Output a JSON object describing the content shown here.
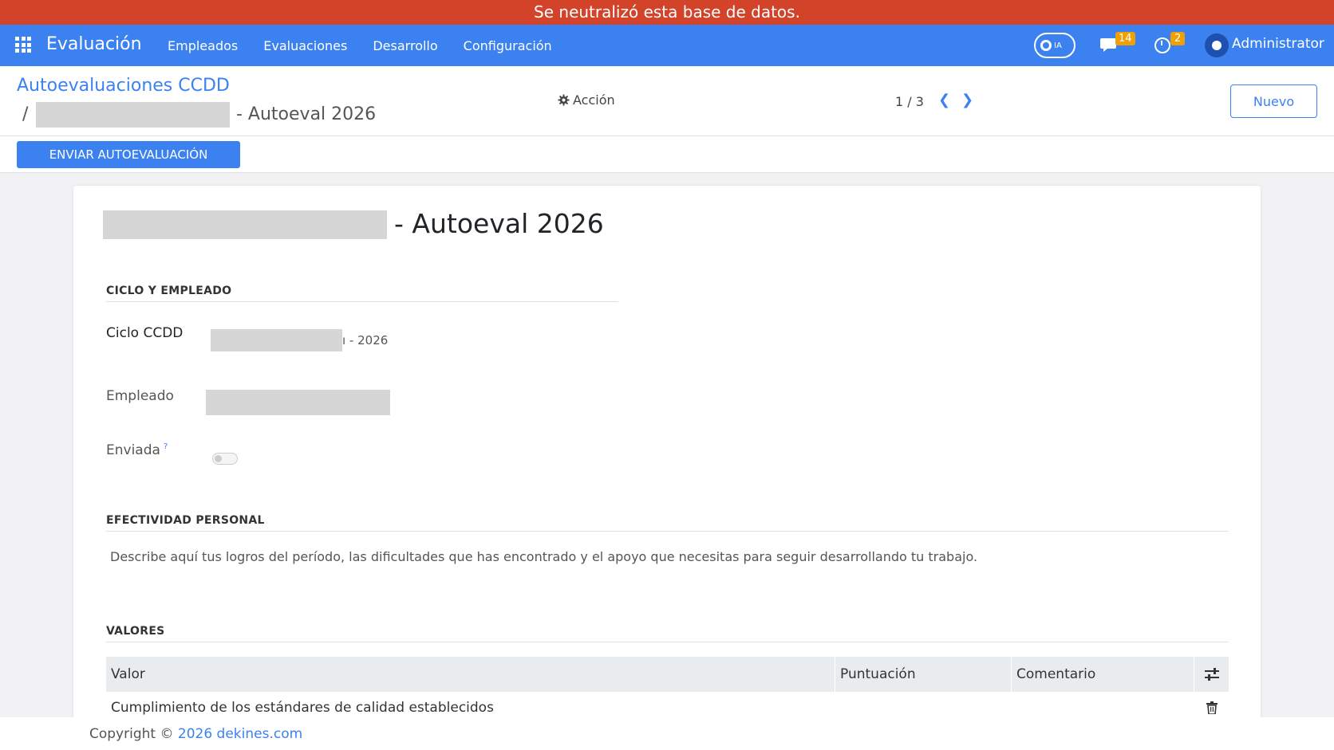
{
  "banner": {
    "text": "Se neutralizó esta base de datos."
  },
  "navbar": {
    "app_title": "Evaluación",
    "menu": [
      "Empleados",
      "Evaluaciones",
      "Desarrollo",
      "Configuración"
    ],
    "ai_label": "IA",
    "chat_count": "14",
    "activity_count": "2",
    "user_name": "Administrator"
  },
  "control_panel": {
    "breadcrumb_parent": "Autoevaluaciones CCDD",
    "breadcrumb_separator": "/",
    "breadcrumb_current": "- Autoeval 2026",
    "action_label": "Acción",
    "pager": "1 / 3",
    "new_label": "Nuevo",
    "send_label": "ENVIAR AUTOEVALUACIÓN"
  },
  "form": {
    "title": "- Autoeval 2026",
    "section_cycle": "CICLO Y EMPLEADO",
    "cycle_label": "Ciclo CCDD",
    "cycle_value_suffix": "ı - 2026",
    "employee_label": "Empleado",
    "sent_label": "Enviada",
    "sent_help": "?",
    "sent_value": false,
    "section_effectiveness": "EFECTIVIDAD PERSONAL",
    "effectiveness_text": "Describe aquí tus logros del período, las dificultades que has encontrado y el apoyo que necesitas para seguir desarrollando tu trabajo.",
    "section_values": "VALORES",
    "values_table": {
      "headers": [
        "Valor",
        "Puntuación",
        "Comentario"
      ],
      "rows": [
        {
          "value": "Cumplimiento de los estándares de calidad establecidos",
          "score": "",
          "comment": ""
        }
      ]
    }
  },
  "footer": {
    "prefix": "Copyright © ",
    "link": "2026 dekines.com"
  },
  "colors": {
    "banner": "#d3432a",
    "primary": "#3b82f0",
    "badge": "#f0a000"
  }
}
